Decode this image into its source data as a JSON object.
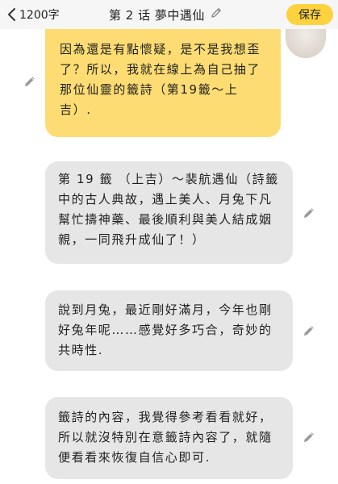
{
  "header": {
    "word_count": "1200字",
    "chapter_title": "第 2 话  夢中遇仙",
    "save_label": "保存"
  },
  "messages": [
    {
      "id": "m1",
      "style": "yellow",
      "text": "因為還是有點懷疑，是不是我想歪了？所以，我就在線上為自己抽了那位仙靈的籤詩（第19籤～上吉）."
    },
    {
      "id": "m2",
      "style": "gray",
      "text": "第 19 籤 （上吉）～裴航遇仙（詩籤中的古人典故，遇上美人、月兔下凡幫忙擣神藥、最後順利與美人結成姻親，一同飛升成仙了！）"
    },
    {
      "id": "m3",
      "style": "gray",
      "text": "說到月兔，最近剛好滿月，今年也剛好兔年呢……感覺好多巧合，奇妙的共時性."
    },
    {
      "id": "m4",
      "style": "gray",
      "text": "籤詩的內容，我覺得參考看看就好，所以就沒特別在意籤詩內容了，就隨便看看來恢復自信心即可."
    }
  ],
  "icons": {
    "back": "chevron-left-icon",
    "edit": "pencil-icon"
  },
  "colors": {
    "accent": "#fdd23f",
    "bubble_user": "#fddd73",
    "bubble_other": "#e6e6e6",
    "topbar": "#f6f6f6"
  }
}
